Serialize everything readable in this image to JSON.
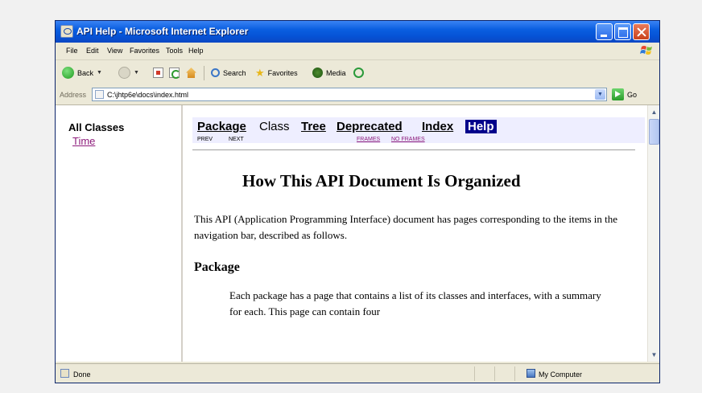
{
  "window": {
    "title": "API Help - Microsoft Internet Explorer"
  },
  "menu": [
    "File",
    "Edit",
    "View",
    "Favorites",
    "Tools",
    "Help"
  ],
  "toolbar": {
    "back_label": "Back",
    "search_label": "Search",
    "favorites_label": "Favorites",
    "media_label": "Media"
  },
  "address": {
    "label": "Address",
    "value": "C:\\jhtp6e\\docs\\index.html",
    "go_label": "Go"
  },
  "left_frame": {
    "heading": "All Classes",
    "links": [
      "Time"
    ]
  },
  "navbar": {
    "items": [
      {
        "label": "Package",
        "style": "link"
      },
      {
        "label": "Class",
        "style": "plain"
      },
      {
        "label": "Tree",
        "style": "link"
      },
      {
        "label": "Deprecated",
        "style": "link"
      },
      {
        "label": "Index",
        "style": "link"
      },
      {
        "label": "Help",
        "style": "selected"
      }
    ],
    "prev": "PREV",
    "next": "NEXT",
    "frames": "FRAMES",
    "no_frames": "NO FRAMES"
  },
  "document": {
    "title": "How This API Document Is Organized",
    "intro": "This API (Application Programming Interface) document has pages corresponding to the items in the navigation bar, described as follows.",
    "section_heading": "Package",
    "section_text": "Each package has a page that contains a list of its classes and interfaces, with a summary for each. This page can contain four"
  },
  "status": {
    "text": "Done",
    "zone": "My Computer"
  },
  "colors": {
    "titlebar": "#0653d6",
    "chrome": "#ece9d8",
    "navbar_bg": "#eeeeff",
    "help_selected_bg": "#00008b",
    "visited_link": "#8d1b7b"
  }
}
